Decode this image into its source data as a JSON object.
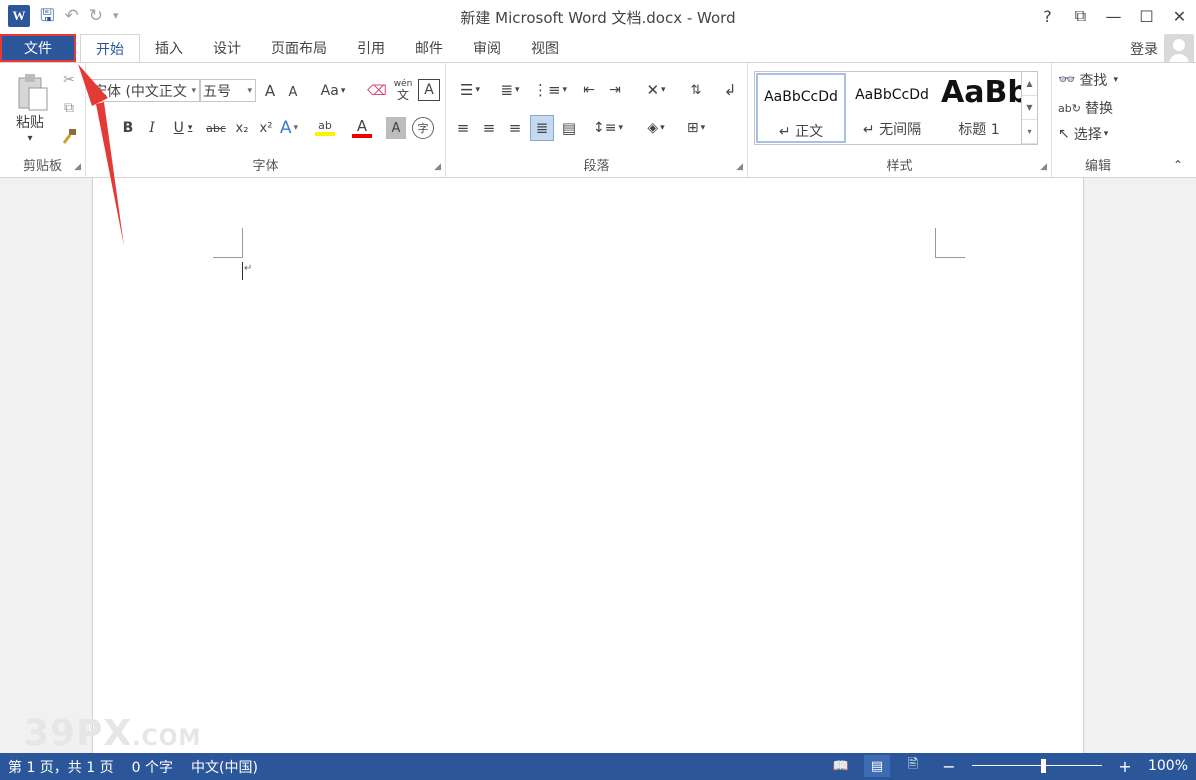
{
  "app": {
    "title": "新建 Microsoft Word 文档.docx - Word",
    "logo": "W",
    "accent_color": "#2b579a",
    "highlight_color": "#e53935"
  },
  "window_controls": [
    "?",
    "⧉",
    "—",
    "☐",
    "✕"
  ],
  "tabs": {
    "file": "文件",
    "items": [
      "开始",
      "插入",
      "设计",
      "页面布局",
      "引用",
      "邮件",
      "审阅",
      "视图"
    ],
    "active": "开始"
  },
  "signin": "登录",
  "ribbon": {
    "clipboard": {
      "label": "剪贴板",
      "paste": "粘贴",
      "paste_dd": "▾"
    },
    "font": {
      "label": "字体",
      "font_name": "宋体 (中文正文",
      "font_size": "五号",
      "grow": "A",
      "shrink": "A",
      "case": "Aa",
      "phonetic": "wén",
      "phonetic_char": "文",
      "border_char": "A",
      "bold": "B",
      "italic": "I",
      "underline": "U",
      "strike": "abc",
      "sub": "x₂",
      "sup": "x²",
      "text_effect": "A",
      "highlight": "ab",
      "font_color": "A",
      "shading_char": "A",
      "enclose": "字"
    },
    "paragraph": {
      "label": "段落"
    },
    "styles": {
      "label": "样式",
      "items": [
        {
          "sample": "AaBbCcDd",
          "name": "↵ 正文"
        },
        {
          "sample": "AaBbCcDd",
          "name": "↵ 无间隔"
        },
        {
          "sample": "AaBb",
          "name": "标题 1"
        }
      ]
    },
    "editing": {
      "label": "编辑",
      "find": "查找",
      "replace": "替换",
      "select": "选择"
    }
  },
  "document": {
    "paragraph_mark": "↵"
  },
  "watermark": {
    "main": "39PX",
    "suffix": ".COM"
  },
  "status": {
    "page": "第 1 页，共 1 页",
    "words": "0 个字",
    "language": "中文(中国)",
    "zoom": "100%",
    "zoom_level": 0.55
  }
}
